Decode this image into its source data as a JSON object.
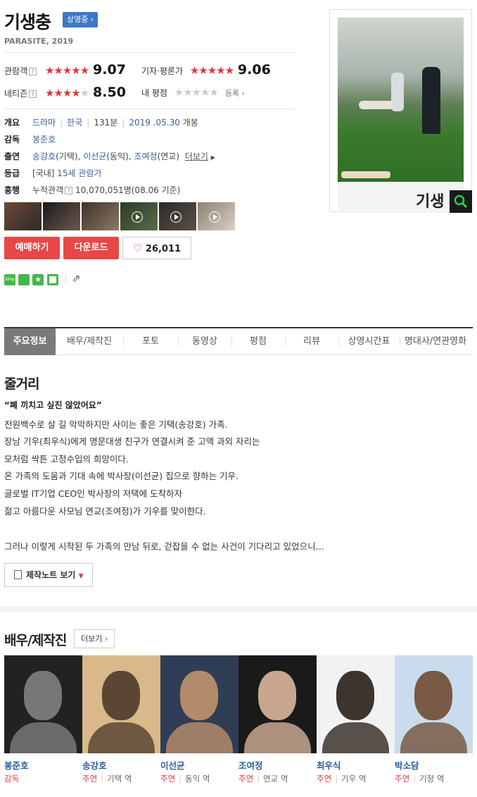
{
  "movie": {
    "title": "기생충",
    "badge": "상영중",
    "subtitle": "PARASITE, 2019"
  },
  "ratings": [
    {
      "label": "관람객",
      "help": "?",
      "stars_on": 4.5,
      "score": "9.07"
    },
    {
      "label": "기자·평론가",
      "help": "",
      "stars_on": 4.5,
      "score": "9.06"
    },
    {
      "label": "네티즌",
      "help": "?",
      "stars_on": 4.0,
      "score": "8.50"
    },
    {
      "label": "내 평점",
      "help": "",
      "stars_on": 0,
      "score": "",
      "action": "등록"
    }
  ],
  "info": {
    "overview_label": "개요",
    "genre": "드라마",
    "country": "한국",
    "runtime": "131분",
    "release": "2019 .05.30",
    "release_suffix": "개봉",
    "director_label": "감독",
    "director": "봉준호",
    "cast_label": "출연",
    "cast": [
      {
        "name": "송강호",
        "role": "(기택)"
      },
      {
        "name": "이선균",
        "role": "(동익)"
      },
      {
        "name": "조여정",
        "role": "(연교)"
      }
    ],
    "cast_more": "더보기",
    "grade_label": "등급",
    "grade_prefix": "[국내]",
    "grade": "15세 관람가",
    "boxoffice_label": "흥행",
    "boxoffice_text": "누적관객",
    "boxoffice_value": "10,070,051명",
    "boxoffice_date": "(08.06 기준)"
  },
  "thumbnails": [
    {
      "color1": "#6b4a36",
      "color2": "#2b2a2a",
      "video": false
    },
    {
      "color1": "#1d1a1a",
      "color2": "#6a5a4e",
      "video": false
    },
    {
      "color1": "#3f3128",
      "color2": "#8b7a66",
      "video": false
    },
    {
      "color1": "#2e3a2a",
      "color2": "#5a6b46",
      "video": true
    },
    {
      "color1": "#2a2a2a",
      "color2": "#5b5046",
      "video": true
    },
    {
      "color1": "#8a8170",
      "color2": "#d8d0c4",
      "video": true
    }
  ],
  "buttons": {
    "reserve": "예매하기",
    "download": "다운로드",
    "likes": "26,011"
  },
  "poster": {
    "title_text": "기생"
  },
  "tabs": [
    "주요정보",
    "배우/제작진",
    "포토",
    "동영상",
    "평점",
    "리뷰",
    "상영시간표",
    "명대사/연관영화"
  ],
  "synopsis": {
    "title": "줄거리",
    "tagline": "“폐 끼치고 싶진 않았어요”",
    "lines": [
      "전원백수로 살 길 막막하지만 사이는 좋은 기택(송강호) 가족.",
      " 장남 기우(최우식)에게 명문대생 친구가 연결시켜 준 고액 과외 자리는",
      " 모처럼 싹튼 고정수입의 희망이다.",
      " 온 가족의 도움과 기대 속에 박사장(이선균) 집으로 향하는 기우.",
      " 글로벌 IT기업 CEO인 박사장의 저택에 도착하자",
      " 젊고 아름다운 사모님 연교(조여정)가 기우를 맞이한다.",
      "",
      " 그러나 이렇게 시작된 두 가족의 만남 뒤로, 걷잡을 수 없는 사건이 기다리고 있었으니…"
    ],
    "note_button": "제작노트 보기"
  },
  "people": {
    "title": "배우/제작진",
    "more": "더보기",
    "list": [
      {
        "name": "봉준호",
        "role": "감독",
        "character": "",
        "bg1": "#222",
        "bg2": "#777"
      },
      {
        "name": "송강호",
        "role": "주연",
        "character": "기택 역",
        "bg1": "#d9b98a",
        "bg2": "#5a4633"
      },
      {
        "name": "이선균",
        "role": "주연",
        "character": "동익 역",
        "bg1": "#2f3e55",
        "bg2": "#b38a6c"
      },
      {
        "name": "조여정",
        "role": "주연",
        "character": "연교 역",
        "bg1": "#1a1a1a",
        "bg2": "#c9a690"
      },
      {
        "name": "최우식",
        "role": "주연",
        "character": "기우 역",
        "bg1": "#f2f2f2",
        "bg2": "#3d342d"
      },
      {
        "name": "박소담",
        "role": "주연",
        "character": "기정 역",
        "bg1": "#c9dced",
        "bg2": "#7a5a45"
      }
    ]
  },
  "colors": {
    "accent_red": "#e94646",
    "star_red": "#e1353a",
    "link_blue": "#3d5f9c",
    "badge_blue": "#3c78c8"
  }
}
